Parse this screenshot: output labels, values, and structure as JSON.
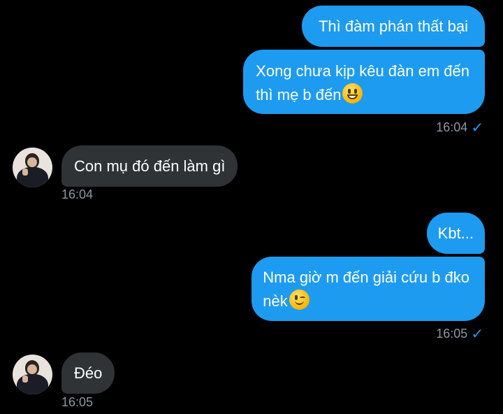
{
  "messages": {
    "m1": {
      "text": "Thì đàm phán thất bại"
    },
    "m2": {
      "line1": "Xong chưa kịp kêu đàn em đến",
      "line2": "thì mẹ b đến"
    },
    "m3": {
      "text": "Con mụ đó đến làm gì"
    },
    "m4": {
      "text": "Kbt..."
    },
    "m5": {
      "line1": "Nma giờ m đến giải cứu b đko",
      "line2": "nèk"
    },
    "m6": {
      "text": "Đéo"
    }
  },
  "timestamps": {
    "t1": "16:04",
    "t2": "16:04",
    "t3": "16:05",
    "t4": "16:05"
  },
  "read_mark": "✓",
  "colors": {
    "outgoing_bubble": "#1d9bf0",
    "incoming_bubble": "#2f3336",
    "background": "#000000",
    "timestamp": "#8b98a5"
  },
  "icons": {
    "grin_emoji": "grinning-face",
    "wink_emoji": "winking-face",
    "read_check": "check-icon"
  }
}
